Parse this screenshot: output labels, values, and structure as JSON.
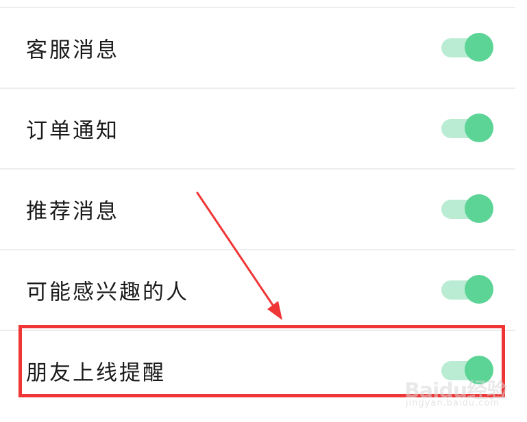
{
  "settings": {
    "items": [
      {
        "label": "客服消息",
        "enabled": true
      },
      {
        "label": "订单通知",
        "enabled": true
      },
      {
        "label": "推荐消息",
        "enabled": true
      },
      {
        "label": "可能感兴趣的人",
        "enabled": true
      },
      {
        "label": "朋友上线提醒",
        "enabled": true
      }
    ]
  },
  "annotation": {
    "highlight_color": "#ef3535",
    "highlighted_item": "朋友上线提醒"
  },
  "toggle_colors": {
    "track": "#b9ecd2",
    "knob": "#5cd496"
  },
  "watermark": {
    "brand": "Baidu经验",
    "url": "jingyan.baidu.com"
  }
}
